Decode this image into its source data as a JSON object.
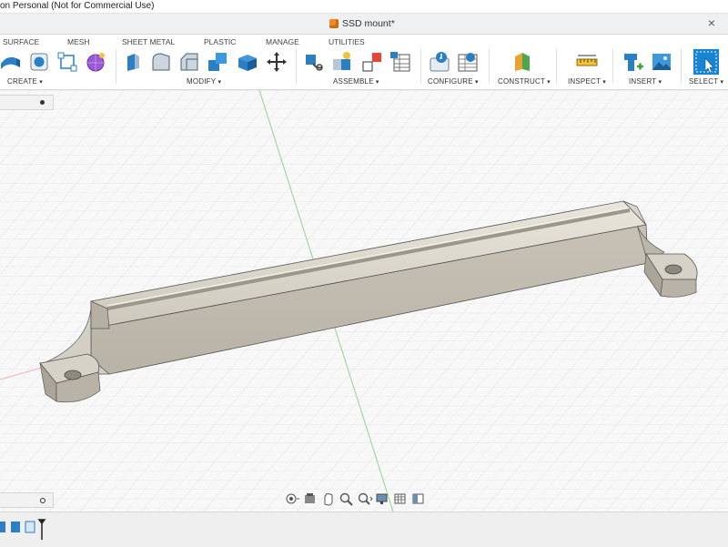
{
  "window": {
    "title_fragment": "on Personal (Not for Commercial Use)",
    "doc_title": "SSD mount*",
    "close_glyph": "×"
  },
  "toolbar": {
    "tabs": [
      "SURFACE",
      "MESH",
      "SHEET METAL",
      "PLASTIC",
      "MANAGE",
      "UTILITIES"
    ],
    "groups": [
      "CREATE",
      "MODIFY",
      "ASSEMBLE",
      "CONFIGURE",
      "CONSTRUCT",
      "INSPECT",
      "INSERT",
      "SELECT"
    ]
  },
  "colors": {
    "accent_blue": "#1a84d4",
    "part_body": "#c9c4b6",
    "part_shadow": "#a9a499",
    "grid": "#d9d9d9",
    "axis_green": "#8fd48f",
    "axis_red": "#f0a0a0"
  },
  "icons": {
    "create": [
      "extrude-icon",
      "sketch-box-icon",
      "sketch-icon",
      "form-icon"
    ],
    "modify": [
      "press-pull-icon",
      "fillet-icon",
      "chamfer-icon",
      "combine-icon",
      "shell-icon",
      "move-icon"
    ],
    "assemble": [
      "new-component-icon",
      "joint-icon",
      "as-built-joint-icon",
      "component-table-icon"
    ],
    "configure": [
      "configure-icon",
      "configure-table-icon"
    ],
    "construct": [
      "plane-icon"
    ],
    "inspect": [
      "measure-icon"
    ],
    "insert": [
      "insert-icon",
      "image-icon"
    ],
    "select": [
      "select-icon"
    ]
  }
}
